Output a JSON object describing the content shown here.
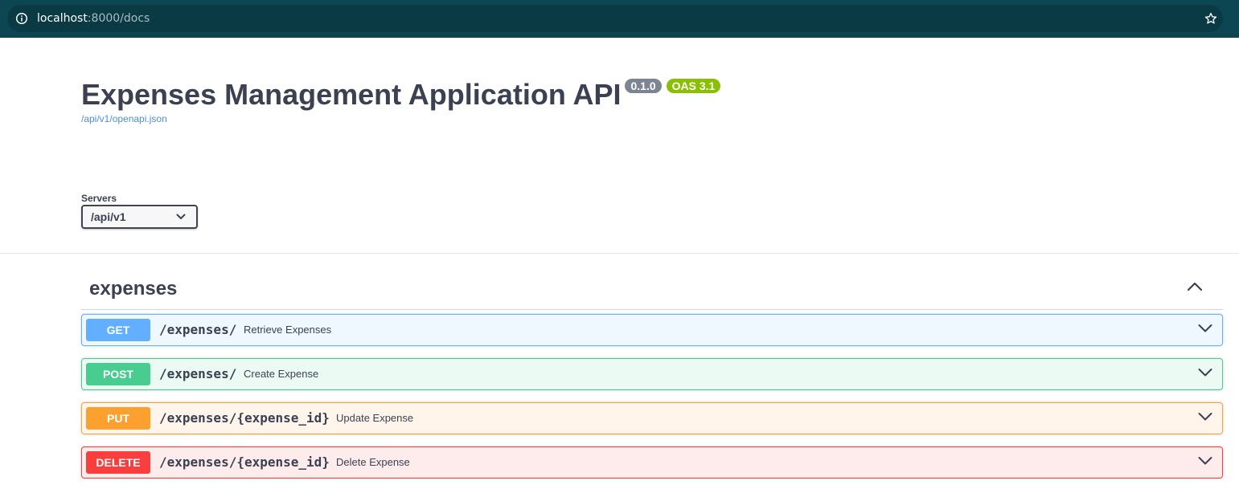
{
  "browser": {
    "url_host": "localhost",
    "url_rest": ":8000/docs",
    "icons": {
      "site_info": "info-circle-icon",
      "bookmark": "star-outline-icon"
    }
  },
  "info": {
    "title": "Expenses Management Application API",
    "version_badge": "0.1.0",
    "oas_badge": "OAS 3.1",
    "spec_link": "/api/v1/openapi.json"
  },
  "servers": {
    "label": "Servers",
    "selected": "/api/v1"
  },
  "tag": {
    "name": "expenses",
    "collapse_icon": "chevron-up-icon"
  },
  "operations": [
    {
      "method": "GET",
      "path": "/expenses/",
      "summary": "Retrieve Expenses",
      "color": "#61affe"
    },
    {
      "method": "POST",
      "path": "/expenses/",
      "summary": "Create Expense",
      "color": "#49cc90"
    },
    {
      "method": "PUT",
      "path": "/expenses/{expense_id}",
      "summary": "Update Expense",
      "color": "#fca130"
    },
    {
      "method": "DELETE",
      "path": "/expenses/{expense_id}",
      "summary": "Delete Expense",
      "color": "#f93e3e"
    }
  ],
  "colors": {
    "browser_bar": "#0c4653",
    "title_text": "#3b4151",
    "version_badge": "#7d8492",
    "oas_badge": "#89bf04",
    "link": "#4990e2"
  }
}
